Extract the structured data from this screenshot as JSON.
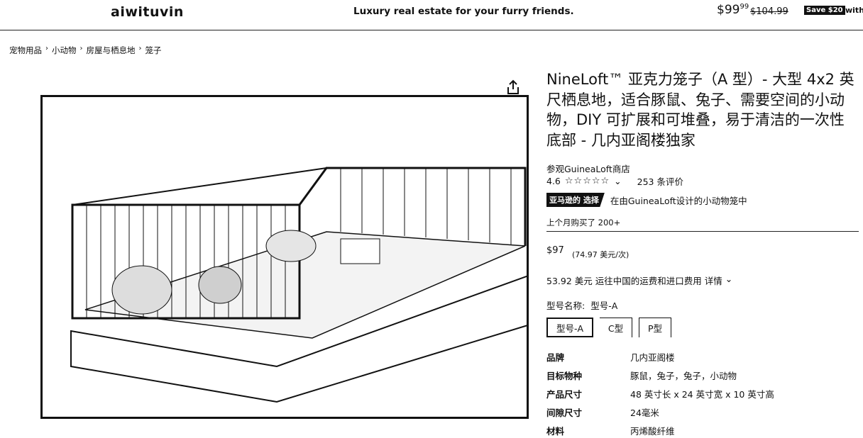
{
  "header": {
    "logo": "aiwituvin",
    "tagline": "Luxury real estate for your furry friends.",
    "price_whole": "$99",
    "price_cents": "99",
    "original_price": "$104.99",
    "save_badge": "Save $20",
    "with_text": "with"
  },
  "breadcrumb": [
    "宠物用品",
    "小动物",
    "房屋与栖息地",
    "笼子"
  ],
  "breadcrumb_sep": "›",
  "product": {
    "title": "NineLoft™ 亚克力笼子（A 型）- 大型 4x2 英尺栖息地，适合豚鼠、兔子、需要空间的小动物，DIY 可扩展和可堆叠，易于清洁的一次性底部 - 几内亚阁楼独家",
    "store_link": "参观GuineaLoft商店",
    "rating": "4.6",
    "stars": "☆☆☆☆☆",
    "rating_chevron": "⌄",
    "reviews": "253 条评价",
    "choice_badge": "亚马逊的 选择",
    "choice_text": "在由GuineaLoft设计的小动物笼中",
    "bought": "上个月购买了 200+",
    "price": "$97",
    "unit_price": "(74.97 美元/次)",
    "shipping": "53.92 美元 运往中国的运费和进口费用",
    "shipping_details": "详情",
    "shipping_chevron": "⌄",
    "model_label": "型号名称:",
    "model_value": "型号-A",
    "options": [
      "型号-A",
      "C型",
      "P型"
    ]
  },
  "specs": [
    {
      "key": "品牌",
      "value": "几内亚阁楼"
    },
    {
      "key": "目标物种",
      "value": "豚鼠，兔子，兔子，小动物"
    },
    {
      "key": "产品尺寸",
      "value": "48 英寸长 x 24 英寸宽 x 10 英寸高"
    },
    {
      "key": "间隙尺寸",
      "value": "24毫米"
    },
    {
      "key": "材料",
      "value": "丙烯酸纤维"
    }
  ],
  "icons": {
    "share": "share-icon"
  }
}
